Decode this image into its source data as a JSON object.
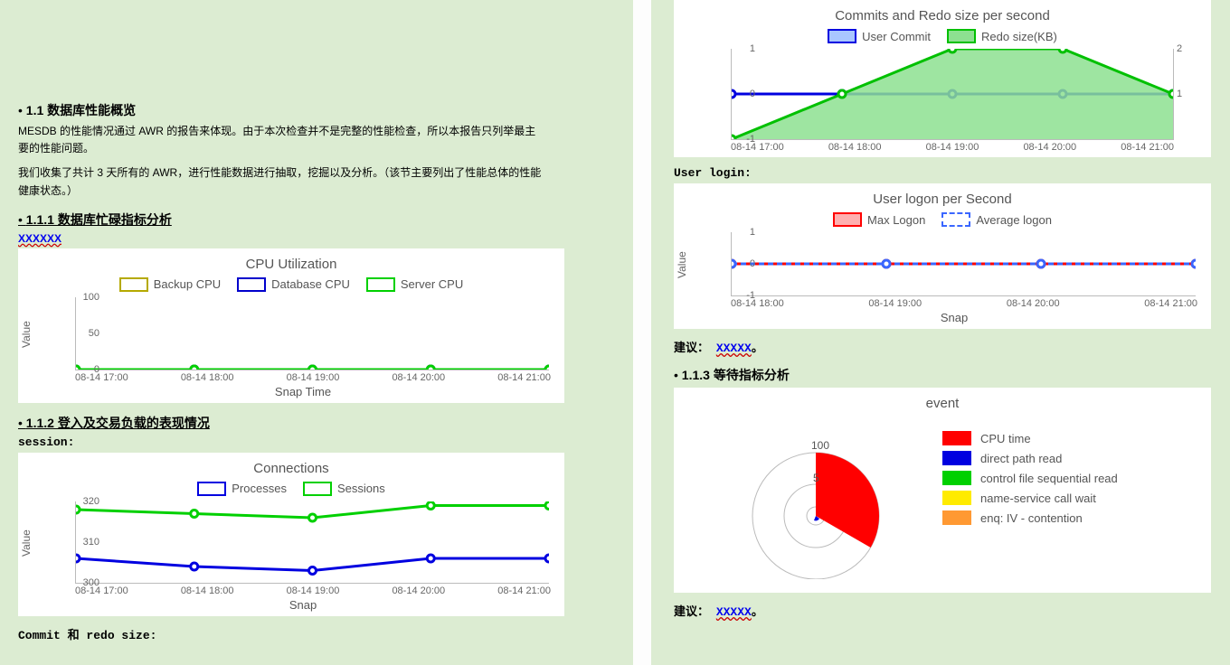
{
  "headings": {
    "s11": "1.1  数据库性能概览",
    "s111": "1.1.1 数据库忙碌指标分析",
    "s112": "1.1.2 登入及交易负载的表现情况",
    "s113": "1.1.3 等待指标分析"
  },
  "text": {
    "para1": "MESDB 的性能情况通过 AWR 的报告来体现。由于本次检查并不是完整的性能检查，所以本报告只列举最主要的性能问题。",
    "para2": "我们收集了共计 3 天所有的 AWR，进行性能数据进行抽取，挖掘以及分析。（该节主要列出了性能总体的性能健康状态。）",
    "placeholder_x": "XXXXXX",
    "session_lbl": "session:",
    "commit_lbl": "Commit 和 redo size:",
    "userlogin_lbl": "User login:",
    "advice_lbl": "建议：",
    "advice_val": "XXXXX"
  },
  "chart_data": [
    {
      "id": "cpu",
      "type": "line",
      "title": "CPU Utilization",
      "xlabel": "Snap Time",
      "ylabel": "Value",
      "categories": [
        "08-14 17:00",
        "08-14 18:00",
        "08-14 19:00",
        "08-14 20:00",
        "08-14 21:00"
      ],
      "ylim": [
        0,
        100
      ],
      "yticks": [
        0,
        50,
        100
      ],
      "series": [
        {
          "name": "Backup CPU",
          "color": "#b5a900",
          "values": [
            0,
            0,
            0,
            0,
            0
          ]
        },
        {
          "name": "Database CPU",
          "color": "#0000cc",
          "values": [
            0,
            0,
            0,
            0,
            0
          ]
        },
        {
          "name": "Server CPU",
          "color": "#00d000",
          "values": [
            0,
            0,
            0,
            0,
            0
          ]
        }
      ]
    },
    {
      "id": "conn",
      "type": "line",
      "title": "Connections",
      "xlabel": "Snap",
      "ylabel": "Value",
      "categories": [
        "08-14 17:00",
        "08-14 18:00",
        "08-14 19:00",
        "08-14 20:00",
        "08-14 21:00"
      ],
      "ylim": [
        300,
        320
      ],
      "yticks": [
        300,
        310,
        320
      ],
      "series": [
        {
          "name": "Processes",
          "color": "#0000e0",
          "values": [
            306,
            304,
            303,
            306,
            306
          ]
        },
        {
          "name": "Sessions",
          "color": "#00d000",
          "values": [
            318,
            317,
            316,
            319,
            319
          ]
        }
      ]
    },
    {
      "id": "commit",
      "type": "line",
      "title": "Commits and Redo size per second",
      "xlabel": "",
      "ylabel": "",
      "categories": [
        "08-14 17:00",
        "08-14 18:00",
        "08-14 19:00",
        "08-14 20:00",
        "08-14 21:00"
      ],
      "ylim": [
        -1,
        1
      ],
      "yticks": [
        -1,
        0,
        1
      ],
      "ylim2": [
        0,
        2
      ],
      "yticks2": [
        1,
        2
      ],
      "series": [
        {
          "name": "User Commit",
          "color": "#0000e0",
          "fill": "#a9c6ff",
          "axis": "left",
          "values": [
            0,
            0,
            0,
            0,
            0
          ]
        },
        {
          "name": "Redo size(KB)",
          "color": "#00c000",
          "fill": "#8de090",
          "axis": "left",
          "area": true,
          "values": [
            -1,
            0,
            1,
            1,
            0
          ]
        }
      ]
    },
    {
      "id": "logon",
      "type": "line",
      "title": "User logon per Second",
      "xlabel": "Snap",
      "ylabel": "Value",
      "categories": [
        "08-14 18:00",
        "08-14 19:00",
        "08-14 20:00",
        "08-14 21:00"
      ],
      "ylim": [
        -1,
        1
      ],
      "yticks": [
        -1,
        0,
        1
      ],
      "series": [
        {
          "name": "Max Logon",
          "color": "#ff0000",
          "fill": "#ffb0b0",
          "values": [
            0,
            0,
            0,
            0
          ]
        },
        {
          "name": "Average logon",
          "color": "#3a66ff",
          "dashed": true,
          "values": [
            0,
            0,
            0,
            0
          ]
        }
      ]
    },
    {
      "id": "event",
      "type": "polar",
      "title": "event",
      "max": 100,
      "ticks": [
        5,
        100
      ],
      "series": [
        {
          "name": "CPU time",
          "color": "#ff0000",
          "value": 100
        },
        {
          "name": "direct path read",
          "color": "#0000e0",
          "value": 5
        },
        {
          "name": "control file sequential read",
          "color": "#00d000",
          "value": 5
        },
        {
          "name": "name-service call wait",
          "color": "#ffeb00",
          "value": 3
        },
        {
          "name": "enq: IV -  contention",
          "color": "#ff9933",
          "value": 2
        }
      ]
    }
  ]
}
